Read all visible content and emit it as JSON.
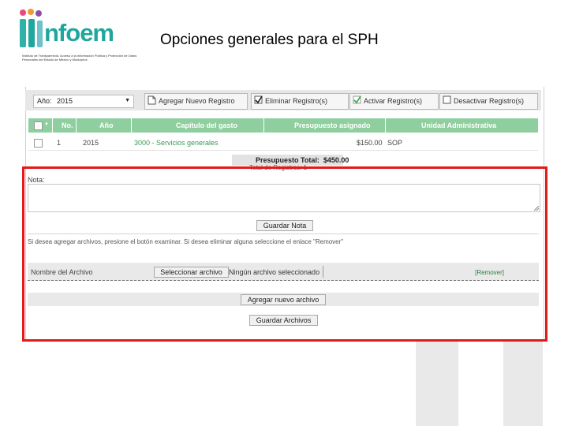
{
  "header": {
    "logo_text": "nfoem",
    "logo_subtitle": "Instituto de Transparencia, Acceso a la Información Pública y Protección de Datos Personales del Estado de México y Municipios",
    "slide_title": "Opciones generales para el SPH"
  },
  "toolbar": {
    "year_label": "Año:",
    "year_value": "2015",
    "add": "Agregar Nuevo Registro",
    "delete": "Eliminar Registro(s)",
    "activate": "Activar Registro(s)",
    "deactivate": "Desactivar Registro(s)"
  },
  "table": {
    "headers": [
      "No.",
      "Año",
      "Capítulo del gasto",
      "Presupuesto asignado",
      "Unidad Administrativa"
    ],
    "rows": [
      {
        "no": "1",
        "year": "2015",
        "chapter": "3000 - Servicios generales",
        "budget": "$150.00",
        "unit": "SOP"
      }
    ]
  },
  "summary": {
    "total": "Presupuesto Total:  $450.00",
    "records": "Total de Registros:  1"
  },
  "note": {
    "label": "Nota:",
    "save_button": "Guardar Nota"
  },
  "files": {
    "info": "Si desea agregar archivos, presione el botón examinar. Si desea eliminar alguna seleccione el enlace \"Remover\"",
    "file_name_label": "Nombre del Archivo",
    "select_button": "Seleccionar archivo",
    "no_file": "Ningún archivo seleccionado",
    "remove_link": "[Remover]",
    "add_button": "Agregar nuevo archivo",
    "save_button": "Guardar Archivos"
  },
  "colors": {
    "accent": "#1fa79d",
    "table_header": "#8fcf9f",
    "highlight": "#e21a1a",
    "logo_dots": [
      "#e84a7f",
      "#f29a2e",
      "#8e4fa3",
      "#2fb3a8"
    ]
  }
}
